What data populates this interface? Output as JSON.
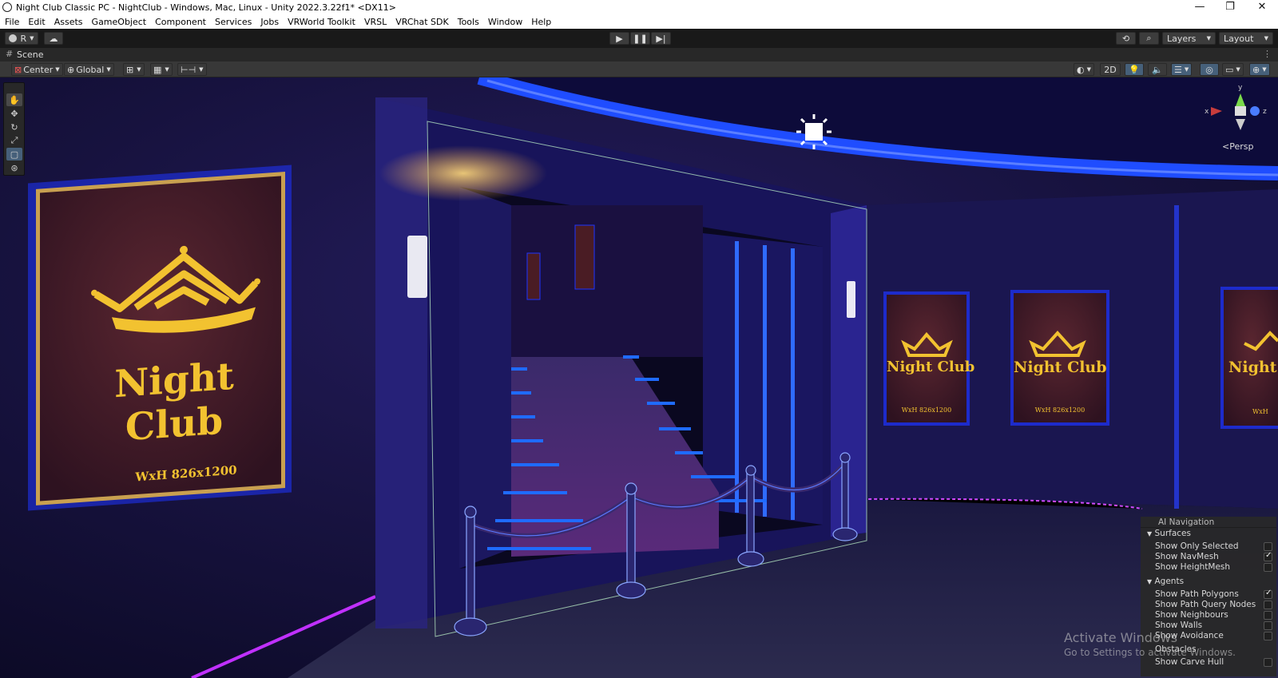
{
  "window": {
    "title": "Night Club Classic PC - NightClub - Windows, Mac, Linux - Unity 2022.3.22f1* <DX11>",
    "controls": [
      "—",
      "❐",
      "✕"
    ]
  },
  "menu": [
    "File",
    "Edit",
    "Assets",
    "GameObject",
    "Component",
    "Services",
    "Jobs",
    "VRWorld Toolkit",
    "VRSL",
    "VRChat SDK",
    "Tools",
    "Window",
    "Help"
  ],
  "toolbar": {
    "account_label": "R",
    "layers_label": "Layers",
    "layout_label": "Layout"
  },
  "scene_tab": {
    "label": "Scene"
  },
  "scene_toolbar": {
    "pivot_label": "Center",
    "space_label": "Global",
    "mode_2d_label": "2D"
  },
  "viewport": {
    "poster_big": {
      "title": "Night Club",
      "size_label": "WxH 826x1200"
    },
    "poster_small": {
      "title": "Night Club",
      "size_label": "WxH 826x1200"
    },
    "poster_partial_title": "Night",
    "poster_partial_size": "WxH",
    "projection_label": "Persp",
    "gizmo_axes": {
      "x": "x",
      "y": "y",
      "z": "z"
    },
    "colors": {
      "neon_blue": "#1f4dff",
      "gold": "#f2c230",
      "poster_bg": "#4a1c24",
      "wall": "#14103a"
    }
  },
  "ai_navigation": {
    "title": "AI Navigation",
    "surfaces_label": "Surfaces",
    "surfaces": [
      {
        "label": "Show Only Selected",
        "checked": false
      },
      {
        "label": "Show NavMesh",
        "checked": true
      },
      {
        "label": "Show HeightMesh",
        "checked": false
      }
    ],
    "agents_label": "Agents",
    "agents": [
      {
        "label": "Show Path Polygons",
        "checked": true
      },
      {
        "label": "Show Path Query Nodes",
        "checked": false
      },
      {
        "label": "Show Neighbours",
        "checked": false
      },
      {
        "label": "Show Walls",
        "checked": false
      },
      {
        "label": "Show Avoidance",
        "checked": false
      }
    ],
    "obstacles_label": "Obstacles",
    "obstacles": [
      {
        "label": "Show Carve Hull",
        "checked": false
      }
    ]
  },
  "watermark": {
    "line1": "Activate Windows",
    "line2": "Go to Settings to activate Windows."
  }
}
